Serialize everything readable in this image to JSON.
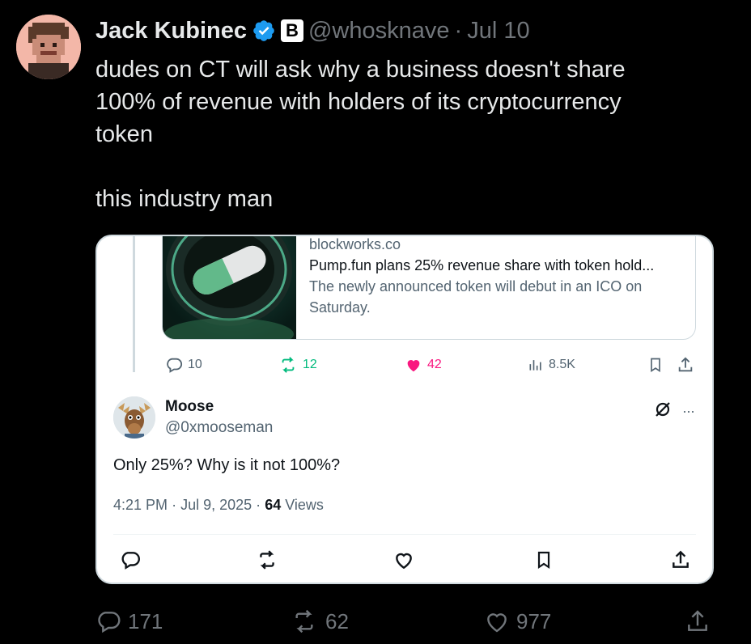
{
  "tweet": {
    "author_name": "Jack Kubinec",
    "handle": "@whosknave",
    "separator": "·",
    "date": "Jul 10",
    "affiliate_badge_letter": "B",
    "text_lines": [
      "dudes on CT will ask why a business doesn't share",
      "100% of revenue with holders of its cryptocurrency",
      "token"
    ],
    "text_line_last": "this industry man",
    "stats": {
      "replies": "171",
      "reposts": "62",
      "likes": "977"
    }
  },
  "quoted": {
    "link_card": {
      "domain": "blockworks.co",
      "title": "Pump.fun plans 25% revenue share with token hold...",
      "description": "The newly announced token will debut in an ICO on Saturday."
    },
    "parent_stats": {
      "replies": "10",
      "reposts": "12",
      "likes": "42",
      "views": "8.5K"
    },
    "reply": {
      "author_name": "Moose",
      "handle": "@0xmooseman",
      "text": "Only 25%? Why is it not 100%?",
      "time": "4:21 PM",
      "sep1": "·",
      "date": "Jul 9, 2025",
      "sep2": "·",
      "views_count": "64",
      "views_label": "Views",
      "more_glyph": "···"
    }
  },
  "colors": {
    "background": "#000000",
    "verified_blue": "#1d9bf0",
    "repost_green": "#00ba7c",
    "like_pink": "#f91880",
    "muted_gray": "#71767b"
  }
}
